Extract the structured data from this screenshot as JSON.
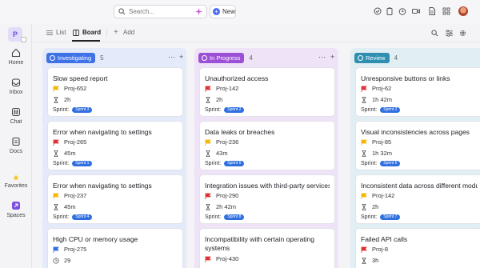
{
  "topbar": {
    "search_placeholder": "Search...",
    "new_label": "New",
    "icons": [
      "check-circle-icon",
      "clipboard-icon",
      "clock-icon",
      "video-icon",
      "document-icon",
      "grid-apps-icon"
    ]
  },
  "sidebar": {
    "workspace_initial": "P",
    "items": [
      {
        "label": "Home",
        "icon": "home-icon"
      },
      {
        "label": "Inbox",
        "icon": "inbox-icon"
      },
      {
        "label": "Chat",
        "icon": "hash-icon"
      },
      {
        "label": "Docs",
        "icon": "document-icon"
      },
      {
        "label": "Favorites",
        "icon": "star-icon"
      },
      {
        "label": "Spaces",
        "icon": "spaces-icon"
      }
    ]
  },
  "view_tabs": {
    "list": "List",
    "board": "Board",
    "add": "Add"
  },
  "columns": [
    {
      "status": "Investigating",
      "count": "5",
      "color": "#3f72e6",
      "cards": [
        {
          "title": "Slow speed report",
          "id": "Proj-652",
          "flag_color": "#f2b705",
          "estimate": "2h",
          "sprint_label": "Sprint:",
          "sprint": "Sprint 3"
        },
        {
          "title": "Error when navigating to settings",
          "id": "Proj-265",
          "flag_color": "#e03131",
          "estimate": "45m",
          "sprint_label": "Sprint:",
          "sprint": "Sprint 1"
        },
        {
          "title": "Error when navigating to settings",
          "id": "Proj-237",
          "flag_color": "#f2b705",
          "estimate": "45m",
          "sprint_label": "Sprint:",
          "sprint": "Sprint 4"
        },
        {
          "title": "High CPU or memory usage",
          "id": "Proj-275",
          "flag_color": "#2f6fe0",
          "estimate": "29"
        }
      ]
    },
    {
      "status": "In Progress",
      "count": "4",
      "color": "#9b50d6",
      "cards": [
        {
          "title": "Unauthorized access",
          "id": "Proj-142",
          "flag_color": "#e03131",
          "estimate": "2h",
          "sprint_label": "Sprint:",
          "sprint": "Sprint 2"
        },
        {
          "title": "Data leaks or breaches",
          "id": "Proj-236",
          "flag_color": "#f2b705",
          "estimate": "43m",
          "sprint_label": "Sprint:",
          "sprint": "Sprint 6"
        },
        {
          "title": "Integration issues with third-party services",
          "id": "Proj-290",
          "flag_color": "#e03131",
          "estimate": "2h 42m",
          "sprint_label": "Sprint:",
          "sprint": "Sprint 8"
        },
        {
          "title": "Incompatibility with certain operating systems",
          "id": "Proj-430",
          "flag_color": "#e03131"
        }
      ]
    },
    {
      "status": "Review",
      "count": "4",
      "color": "#2f8fb0",
      "cards": [
        {
          "title": "Unresponsive buttons or links",
          "id": "Proj-62",
          "flag_color": "#e03131",
          "estimate": "1h 42m",
          "sprint_label": "Sprint:",
          "sprint": "Sprint 2"
        },
        {
          "title": "Visual inconsistencies across pages",
          "id": "Proj-85",
          "flag_color": "#f2b705",
          "estimate": "1h 32m",
          "sprint_label": "Sprint:",
          "sprint": "Sprint 6"
        },
        {
          "title": "Inconsistent data across different modules",
          "id": "Proj-142",
          "flag_color": "#f2b705",
          "estimate": "2h",
          "sprint_label": "Sprint:",
          "sprint": "Sprint 7"
        },
        {
          "title": "Failed API calls",
          "id": "Proj-8",
          "flag_color": "#e03131",
          "estimate": "3h"
        }
      ]
    }
  ]
}
